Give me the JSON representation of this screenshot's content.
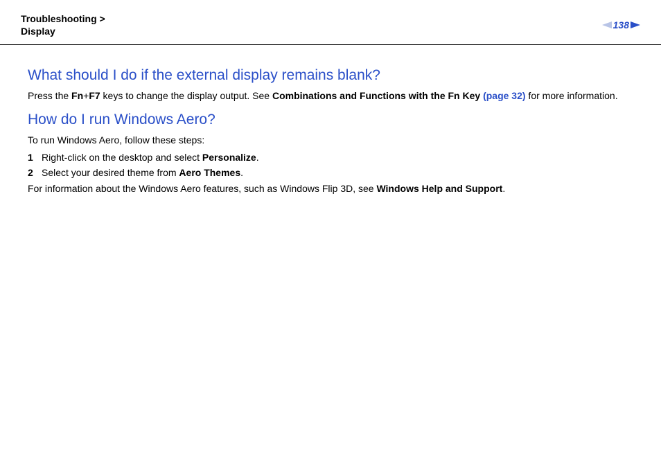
{
  "header": {
    "breadcrumb_1": "Troubleshooting",
    "breadcrumb_sep": ">",
    "breadcrumb_2": "Display",
    "page_number": "138"
  },
  "section1": {
    "heading": "What should I do if the external display remains blank?",
    "p1_a": "Press the ",
    "p1_b": "Fn",
    "p1_c": "+",
    "p1_d": "F7",
    "p1_e": " keys to change the display output. See ",
    "p1_f": "Combinations and Functions with the Fn Key",
    "p1_g": " ",
    "p1_link": "(page 32)",
    "p1_h": " for more information."
  },
  "section2": {
    "heading": "How do I run Windows Aero?",
    "intro": "To run Windows Aero, follow these steps:",
    "steps": [
      {
        "num": "1",
        "a": "Right-click on the desktop and select ",
        "b": "Personalize",
        "c": "."
      },
      {
        "num": "2",
        "a": "Select your desired theme from ",
        "b": "Aero Themes",
        "c": "."
      }
    ],
    "outro_a": "For information about the Windows Aero features, such as Windows Flip 3D, see ",
    "outro_b": "Windows Help and Support",
    "outro_c": "."
  }
}
